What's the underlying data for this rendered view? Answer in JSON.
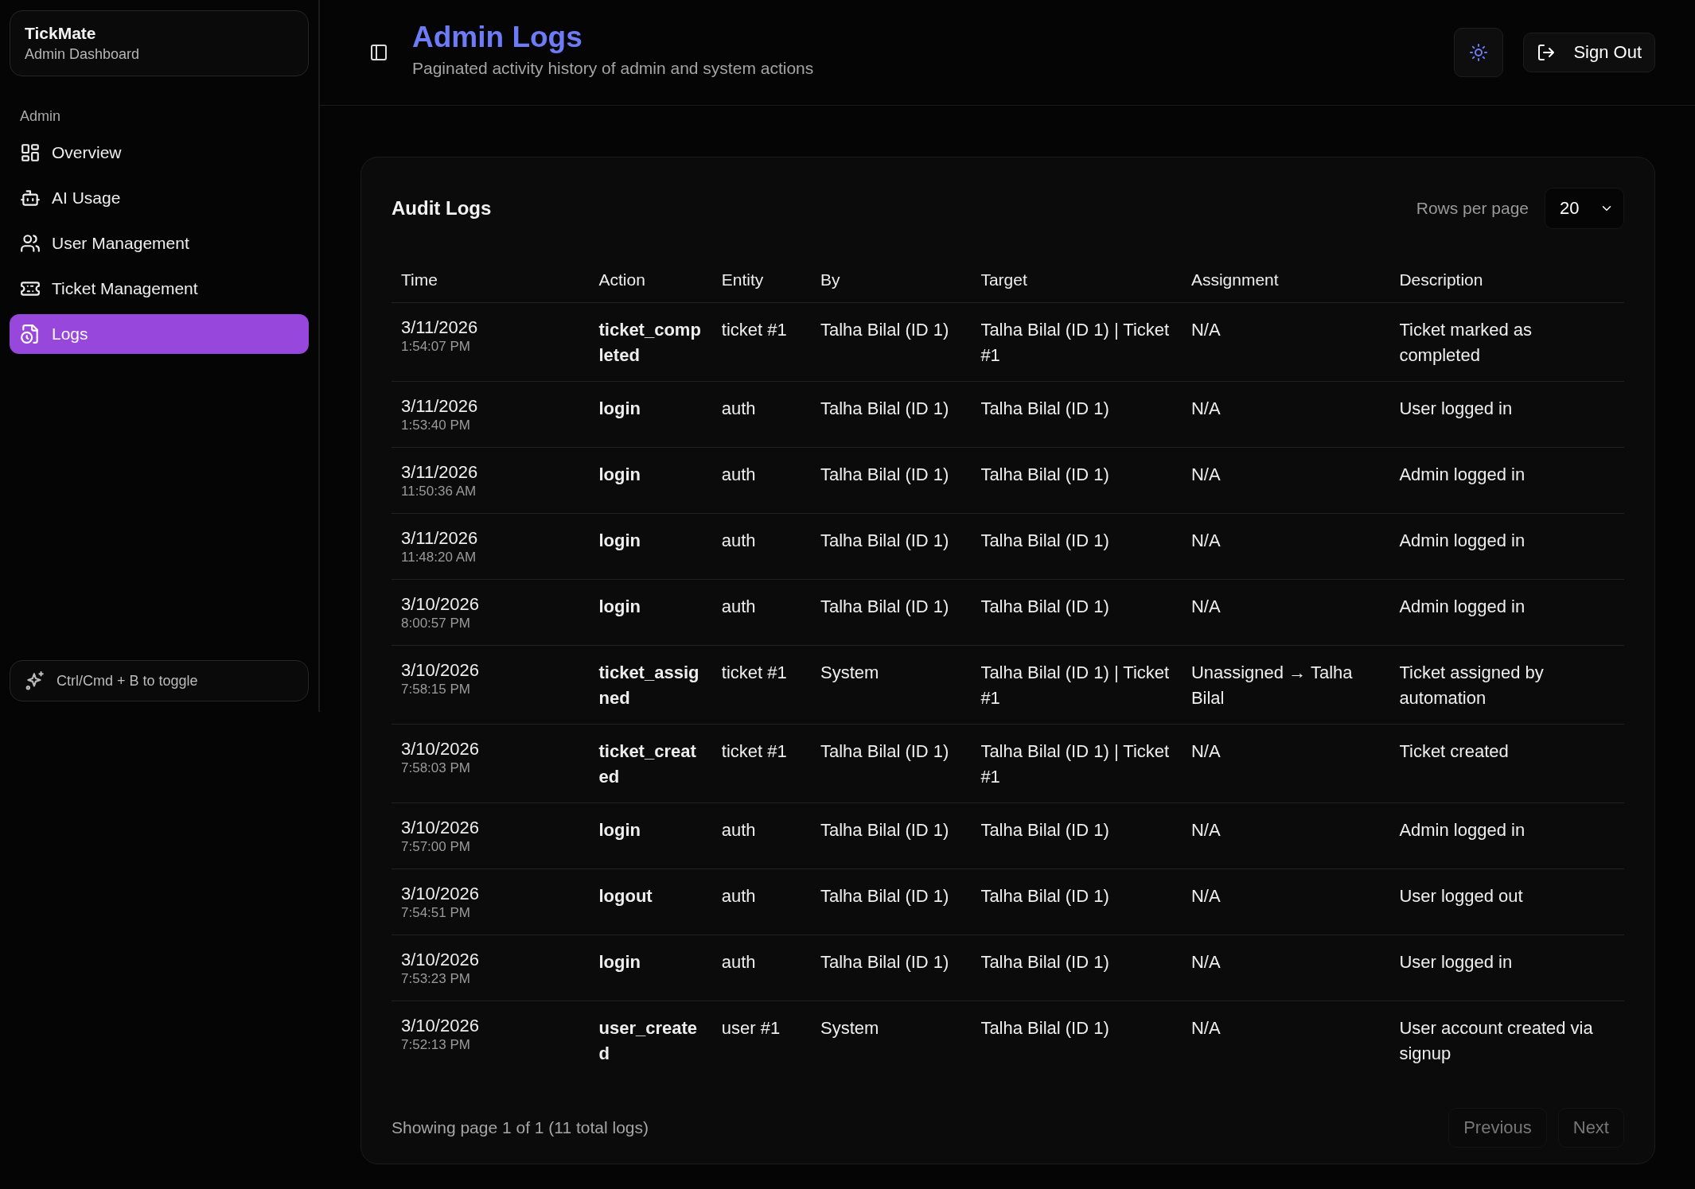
{
  "sidebar": {
    "brand": {
      "title": "TickMate",
      "subtitle": "Admin Dashboard"
    },
    "section": "Admin",
    "items": [
      {
        "label": "Overview",
        "selected": false
      },
      {
        "label": "AI Usage",
        "selected": false
      },
      {
        "label": "User Management",
        "selected": false
      },
      {
        "label": "Ticket Management",
        "selected": false
      },
      {
        "label": "Logs",
        "selected": true
      }
    ],
    "hint": "Ctrl/Cmd + B to toggle"
  },
  "header": {
    "title": "Admin Logs",
    "subtitle": "Paginated activity history of admin and system actions",
    "sign_out": "Sign Out"
  },
  "card": {
    "title": "Audit Logs",
    "rows_per_page_label": "Rows per page",
    "rows_per_page": "20",
    "table": {
      "columns": [
        "Time",
        "Action",
        "Entity",
        "By",
        "Target",
        "Assignment",
        "Description"
      ],
      "rows": [
        {
          "date": "3/11/2026",
          "time": "1:54:07 PM",
          "action": "ticket_completed",
          "entity": "ticket #1",
          "by": "Talha Bilal (ID 1)",
          "target": "Talha Bilal (ID 1) | Ticket #1",
          "assignment": "N/A",
          "description": "Ticket marked as completed"
        },
        {
          "date": "3/11/2026",
          "time": "1:53:40 PM",
          "action": "login",
          "entity": "auth",
          "by": "Talha Bilal (ID 1)",
          "target": "Talha Bilal (ID 1)",
          "assignment": "N/A",
          "description": "User logged in"
        },
        {
          "date": "3/11/2026",
          "time": "11:50:36 AM",
          "action": "login",
          "entity": "auth",
          "by": "Talha Bilal (ID 1)",
          "target": "Talha Bilal (ID 1)",
          "assignment": "N/A",
          "description": "Admin logged in"
        },
        {
          "date": "3/11/2026",
          "time": "11:48:20 AM",
          "action": "login",
          "entity": "auth",
          "by": "Talha Bilal (ID 1)",
          "target": "Talha Bilal (ID 1)",
          "assignment": "N/A",
          "description": "Admin logged in"
        },
        {
          "date": "3/10/2026",
          "time": "8:00:57 PM",
          "action": "login",
          "entity": "auth",
          "by": "Talha Bilal (ID 1)",
          "target": "Talha Bilal (ID 1)",
          "assignment": "N/A",
          "description": "Admin logged in"
        },
        {
          "date": "3/10/2026",
          "time": "7:58:15 PM",
          "action": "ticket_assigned",
          "entity": "ticket #1",
          "by": "System",
          "target": "Talha Bilal (ID 1) | Ticket #1",
          "assignment": "Unassigned → Talha Bilal",
          "description": "Ticket assigned by automation"
        },
        {
          "date": "3/10/2026",
          "time": "7:58:03 PM",
          "action": "ticket_created",
          "entity": "ticket #1",
          "by": "Talha Bilal (ID 1)",
          "target": "Talha Bilal (ID 1) | Ticket #1",
          "assignment": "N/A",
          "description": "Ticket created"
        },
        {
          "date": "3/10/2026",
          "time": "7:57:00 PM",
          "action": "login",
          "entity": "auth",
          "by": "Talha Bilal (ID 1)",
          "target": "Talha Bilal (ID 1)",
          "assignment": "N/A",
          "description": "Admin logged in"
        },
        {
          "date": "3/10/2026",
          "time": "7:54:51 PM",
          "action": "logout",
          "entity": "auth",
          "by": "Talha Bilal (ID 1)",
          "target": "Talha Bilal (ID 1)",
          "assignment": "N/A",
          "description": "User logged out"
        },
        {
          "date": "3/10/2026",
          "time": "7:53:23 PM",
          "action": "login",
          "entity": "auth",
          "by": "Talha Bilal (ID 1)",
          "target": "Talha Bilal (ID 1)",
          "assignment": "N/A",
          "description": "User logged in"
        },
        {
          "date": "3/10/2026",
          "time": "7:52:13 PM",
          "action": "user_created",
          "entity": "user #1",
          "by": "System",
          "target": "Talha Bilal (ID 1)",
          "assignment": "N/A",
          "description": "User account created via signup"
        }
      ]
    },
    "footer": {
      "status": "Showing page 1 of 1 (11 total logs)",
      "buttons": [
        {
          "label": "Previous",
          "disabled": true
        },
        {
          "label": "Next",
          "disabled": true
        }
      ]
    }
  }
}
